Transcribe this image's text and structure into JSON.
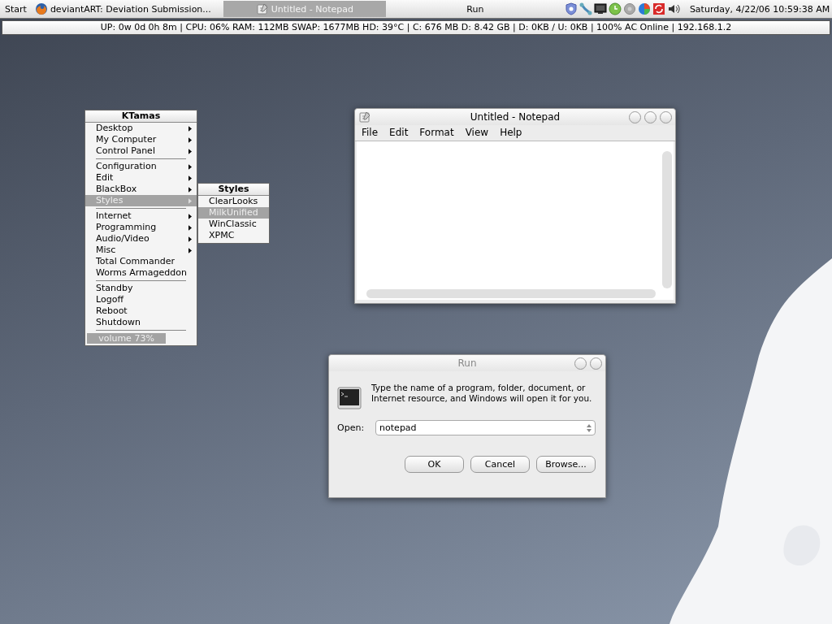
{
  "taskbar": {
    "start": "Start",
    "tasks": [
      {
        "label": "deviantART: Deviation Submission...",
        "kind": "browser",
        "selected": false
      },
      {
        "label": "Untitled - Notepad",
        "kind": "notepad",
        "selected": true
      },
      {
        "label": "Run",
        "kind": "plain",
        "selected": false
      }
    ],
    "clock": "Saturday, 4/22/06 10:59:38 AM"
  },
  "status_bar": "UP: 0w 0d 0h 8m | CPU: 06% RAM: 112MB SWAP: 1677MB HD: 39°C | C: 676 MB D: 8.42 GB | D: 0KB / U: 0KB | 100% AC Online | 192.168.1.2",
  "menu": {
    "title": "KTamas",
    "sections": [
      [
        {
          "label": "Desktop",
          "submenu": true,
          "selected": false
        },
        {
          "label": "My Computer",
          "submenu": true,
          "selected": false
        },
        {
          "label": "Control Panel",
          "submenu": true,
          "selected": false
        }
      ],
      [
        {
          "label": "Configuration",
          "submenu": true,
          "selected": false
        },
        {
          "label": "Edit",
          "submenu": true,
          "selected": false
        },
        {
          "label": "BlackBox",
          "submenu": true,
          "selected": false
        },
        {
          "label": "Styles",
          "submenu": true,
          "selected": true
        }
      ],
      [
        {
          "label": "Internet",
          "submenu": true,
          "selected": false
        },
        {
          "label": "Programming",
          "submenu": true,
          "selected": false
        },
        {
          "label": "Audio/Video",
          "submenu": true,
          "selected": false
        },
        {
          "label": "Misc",
          "submenu": true,
          "selected": false
        },
        {
          "label": "Total Commander",
          "submenu": false,
          "selected": false
        },
        {
          "label": "Worms Armageddon",
          "submenu": false,
          "selected": false
        }
      ],
      [
        {
          "label": "Standby",
          "submenu": false,
          "selected": false
        },
        {
          "label": "Logoff",
          "submenu": false,
          "selected": false
        },
        {
          "label": "Reboot",
          "submenu": false,
          "selected": false
        },
        {
          "label": "Shutdown",
          "submenu": false,
          "selected": false
        }
      ]
    ],
    "volume": {
      "label": "volume 73%",
      "level": 0.73
    }
  },
  "submenu": {
    "title": "Styles",
    "items": [
      {
        "label": "ClearLooks",
        "selected": false
      },
      {
        "label": "MilkUnified",
        "selected": true
      },
      {
        "label": "WinClassic",
        "selected": false
      },
      {
        "label": "XPMC",
        "selected": false
      }
    ]
  },
  "notepad": {
    "title": "Untitled - Notepad",
    "menus": [
      "File",
      "Edit",
      "Format",
      "View",
      "Help"
    ]
  },
  "run_dialog": {
    "title": "Run",
    "message": "Type the name of a program, folder, document, or Internet resource, and Windows will open it for you.",
    "open_label": "Open:",
    "value": "notepad",
    "buttons": [
      "OK",
      "Cancel",
      "Browse..."
    ]
  }
}
